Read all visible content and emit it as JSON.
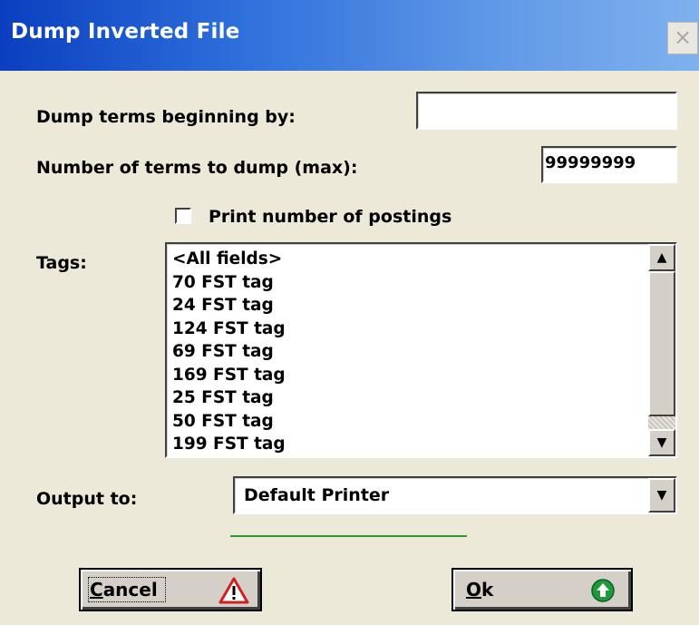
{
  "window": {
    "title": "Dump Inverted File",
    "close_glyph": "×"
  },
  "fields": {
    "begin_label": "Dump terms beginning by:",
    "begin_value": "",
    "number_label": "Number of terms to dump (max):",
    "number_value": "99999999",
    "checkbox_label": "Print number of postings",
    "checkbox_checked": false
  },
  "tags": {
    "label": "Tags:",
    "items": [
      "<All fields>",
      "70 FST tag",
      "24 FST tag",
      "124 FST tag",
      "69 FST tag",
      "169 FST tag",
      "25 FST tag",
      "50 FST tag",
      "199 FST tag"
    ]
  },
  "output": {
    "label": "Output to:",
    "selected": "Default Printer"
  },
  "buttons": {
    "cancel_label": "Cancel",
    "cancel_mnemonic": "C",
    "cancel_rest": "ancel",
    "ok_label": "Ok",
    "ok_mnemonic": "O",
    "ok_rest": "k"
  },
  "icons": {
    "warning_icon": "warning-triangle",
    "ok_icon": "green-up-arrow-circle",
    "scroll_up": "▲",
    "scroll_down": "▼"
  },
  "colors": {
    "title_start": "#0a3fbf",
    "title_end": "#7fb1ee",
    "dialog_bg": "#ece9d8",
    "progress": "#2e9a2e",
    "ok_icon_green": "#1f9a3a",
    "warning_red": "#d02020"
  }
}
